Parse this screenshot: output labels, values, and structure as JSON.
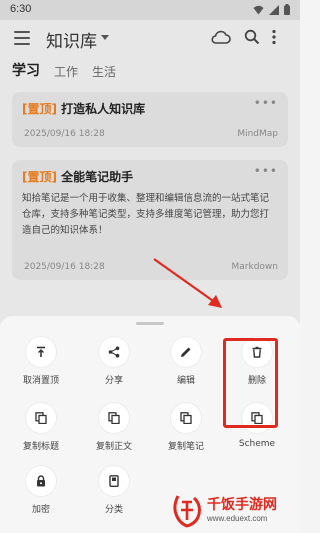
{
  "status": {
    "time": "6:30"
  },
  "appbar": {
    "title": "知识库"
  },
  "tabs": [
    {
      "label": "学习",
      "active": true
    },
    {
      "label": "工作",
      "active": false
    },
    {
      "label": "生活",
      "active": false
    }
  ],
  "notes": [
    {
      "tag": "[置顶]",
      "title": "打造私人知识库",
      "date": "2025/09/16 18:28",
      "type": "MindMap",
      "body": ""
    },
    {
      "tag": "[置顶]",
      "title": "全能笔记助手",
      "date": "2025/09/16 18:28",
      "type": "Markdown",
      "body": "知拾笔记是一个用于收集、整理和编辑信息流的一站式笔记仓库，支持多种笔记类型，支持多维度笔记管理，助力您打造自己的知识体系！"
    }
  ],
  "sheet": {
    "actions": [
      {
        "label": "取消置顶",
        "icon": "unpin-icon"
      },
      {
        "label": "分享",
        "icon": "share-icon"
      },
      {
        "label": "编辑",
        "icon": "edit-icon"
      },
      {
        "label": "删除",
        "icon": "delete-icon"
      },
      {
        "label": "复制标题",
        "icon": "copy-icon"
      },
      {
        "label": "复制正文",
        "icon": "copy-icon"
      },
      {
        "label": "复制笔记",
        "icon": "copy-icon"
      },
      {
        "label": "Scheme",
        "icon": "copy-icon"
      },
      {
        "label": "加密",
        "icon": "lock-icon"
      },
      {
        "label": "分类",
        "icon": "category-icon"
      }
    ]
  },
  "watermark": {
    "text": "千饭手游网",
    "url": "www.eduext.com"
  },
  "colors": {
    "accent": "#e67a1e",
    "highlight": "#e02a1f",
    "sheet": "#f6f6f6"
  }
}
